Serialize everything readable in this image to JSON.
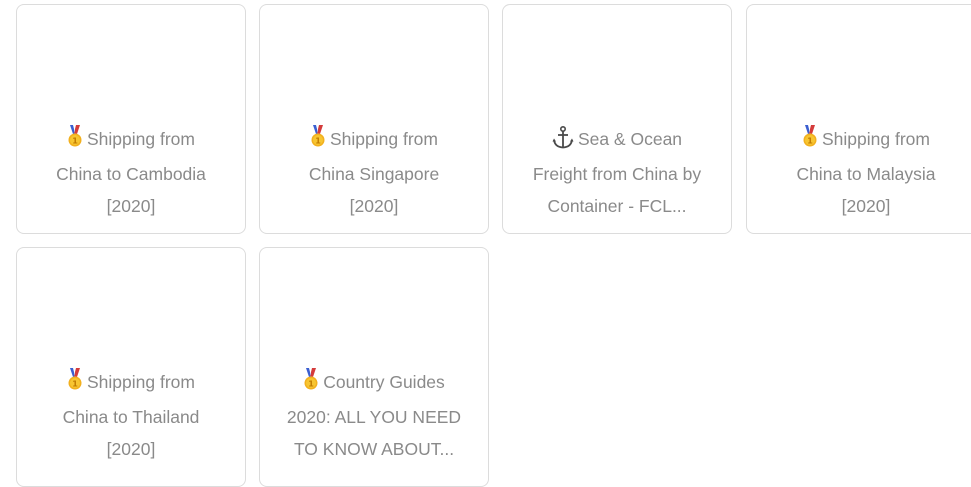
{
  "cards": [
    {
      "icon": "medal-icon",
      "line1": "Shipping from",
      "line2": "China to Cambodia",
      "line3": "[2020]"
    },
    {
      "icon": "medal-icon",
      "line1": "Shipping from",
      "line2": "China Singapore",
      "line3": "[2020]"
    },
    {
      "icon": "anchor-icon",
      "line1": "Sea & Ocean",
      "line2": "Freight from China by",
      "line3": "Container - FCL..."
    },
    {
      "icon": "medal-icon",
      "line1": "Shipping from",
      "line2": "China to Malaysia",
      "line3": "[2020]"
    },
    {
      "icon": "medal-icon",
      "line1": "Shipping from",
      "line2": "China to Thailand",
      "line3": "[2020]"
    },
    {
      "icon": "medal-icon",
      "line1": "Country Guides",
      "line2": "2020: ALL YOU NEED",
      "line3": "TO KNOW ABOUT..."
    }
  ]
}
